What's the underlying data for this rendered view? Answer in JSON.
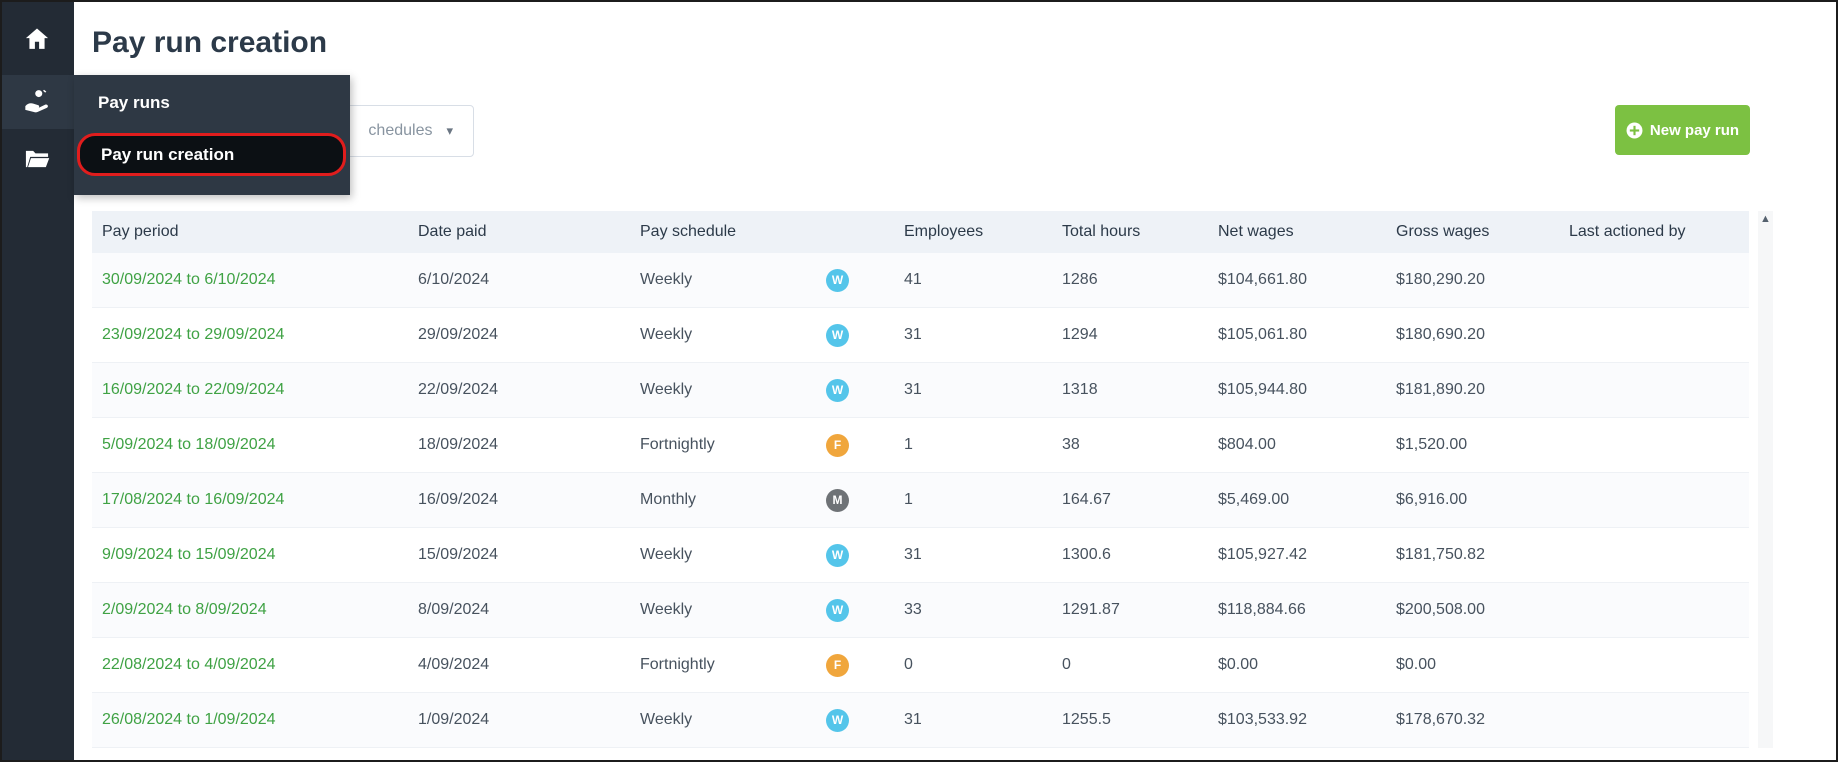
{
  "page": {
    "title": "Pay run creation"
  },
  "sidebar": {
    "items": [
      {
        "icon": "home-icon"
      },
      {
        "icon": "pay-runs-icon"
      },
      {
        "icon": "folder-icon"
      }
    ]
  },
  "flyout": {
    "items": [
      {
        "label": "Pay runs",
        "active": false
      },
      {
        "label": "Pay run creation",
        "active": true,
        "annotation": "red-outline"
      }
    ]
  },
  "toolbar": {
    "schedule_filter_visible_text": "chedules",
    "new_pay_run_label": "New pay run"
  },
  "table": {
    "headers": [
      "Pay period",
      "Date paid",
      "Pay schedule",
      "Employees",
      "Total hours",
      "Net wages",
      "Gross wages",
      "Last actioned by"
    ],
    "rows": [
      {
        "pay_period": "30/09/2024 to 6/10/2024",
        "date_paid": "6/10/2024",
        "pay_schedule": "Weekly",
        "badge": "W",
        "badge_color": "blue",
        "employees": "41",
        "total_hours": "1286",
        "net_wages": "$104,661.80",
        "gross_wages": "$180,290.20",
        "last_actioned_by": ""
      },
      {
        "pay_period": "23/09/2024 to 29/09/2024",
        "date_paid": "29/09/2024",
        "pay_schedule": "Weekly",
        "badge": "W",
        "badge_color": "blue",
        "employees": "31",
        "total_hours": "1294",
        "net_wages": "$105,061.80",
        "gross_wages": "$180,690.20",
        "last_actioned_by": ""
      },
      {
        "pay_period": "16/09/2024 to 22/09/2024",
        "date_paid": "22/09/2024",
        "pay_schedule": "Weekly",
        "badge": "W",
        "badge_color": "blue",
        "employees": "31",
        "total_hours": "1318",
        "net_wages": "$105,944.80",
        "gross_wages": "$181,890.20",
        "last_actioned_by": ""
      },
      {
        "pay_period": "5/09/2024 to 18/09/2024",
        "date_paid": "18/09/2024",
        "pay_schedule": "Fortnightly",
        "badge": "F",
        "badge_color": "orange",
        "employees": "1",
        "total_hours": "38",
        "net_wages": "$804.00",
        "gross_wages": "$1,520.00",
        "last_actioned_by": ""
      },
      {
        "pay_period": "17/08/2024 to 16/09/2024",
        "date_paid": "16/09/2024",
        "pay_schedule": "Monthly",
        "badge": "M",
        "badge_color": "gray",
        "employees": "1",
        "total_hours": "164.67",
        "net_wages": "$5,469.00",
        "gross_wages": "$6,916.00",
        "last_actioned_by": ""
      },
      {
        "pay_period": "9/09/2024 to 15/09/2024",
        "date_paid": "15/09/2024",
        "pay_schedule": "Weekly",
        "badge": "W",
        "badge_color": "blue",
        "employees": "31",
        "total_hours": "1300.6",
        "net_wages": "$105,927.42",
        "gross_wages": "$181,750.82",
        "last_actioned_by": ""
      },
      {
        "pay_period": "2/09/2024 to 8/09/2024",
        "date_paid": "8/09/2024",
        "pay_schedule": "Weekly",
        "badge": "W",
        "badge_color": "blue",
        "employees": "33",
        "total_hours": "1291.87",
        "net_wages": "$118,884.66",
        "gross_wages": "$200,508.00",
        "last_actioned_by": ""
      },
      {
        "pay_period": "22/08/2024 to 4/09/2024",
        "date_paid": "4/09/2024",
        "pay_schedule": "Fortnightly",
        "badge": "F",
        "badge_color": "orange",
        "employees": "0",
        "total_hours": "0",
        "net_wages": "$0.00",
        "gross_wages": "$0.00",
        "last_actioned_by": ""
      },
      {
        "pay_period": "26/08/2024 to 1/09/2024",
        "date_paid": "1/09/2024",
        "pay_schedule": "Weekly",
        "badge": "W",
        "badge_color": "blue",
        "employees": "31",
        "total_hours": "1255.5",
        "net_wages": "$103,533.92",
        "gross_wages": "$178,670.32",
        "last_actioned_by": ""
      }
    ]
  },
  "scrollbar": {
    "up_arrow": "▲"
  },
  "colors": {
    "accent_green": "#7cc142",
    "link_green": "#3fa244",
    "badge_blue": "#54c5ea",
    "badge_orange": "#f0a63c",
    "badge_gray": "#6e7276",
    "annotation_red": "#e11d1d",
    "sidebar_bg": "#232b35",
    "flyout_bg": "#2e3844"
  }
}
